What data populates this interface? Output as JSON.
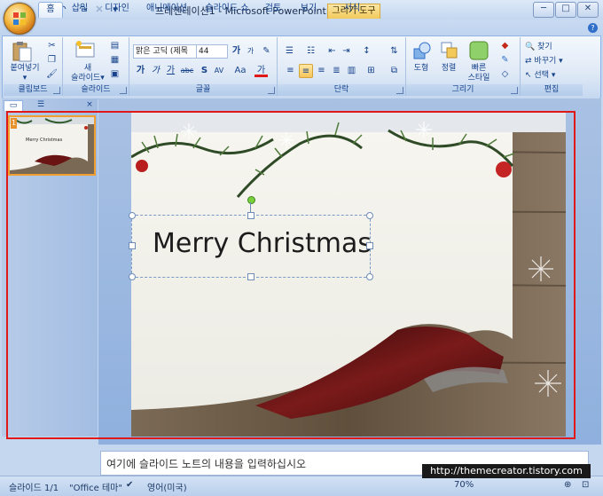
{
  "window": {
    "title": "프레젠테이션1 - Microsoft PowerPoint",
    "context_tab": "그리기 도구",
    "min": "─",
    "max": "□",
    "close": "✕"
  },
  "qat": {
    "save": "💾",
    "undo": "↶",
    "redo": "↷",
    "more": "▾"
  },
  "tabs": [
    {
      "label": "홈",
      "active": true
    },
    {
      "label": "삽입"
    },
    {
      "label": "디자인"
    },
    {
      "label": "애니메이션"
    },
    {
      "label": "슬라이드 쇼"
    },
    {
      "label": "검토"
    },
    {
      "label": "보기"
    },
    {
      "label": "서식"
    }
  ],
  "ribbon": {
    "clipboard": {
      "label": "클립보드",
      "paste": "붙여넣기",
      "paste_arrow": "▾"
    },
    "slides": {
      "label": "슬라이드",
      "new_slide_line1": "새",
      "new_slide_line2": "슬라이드",
      "arrow": "▾"
    },
    "font": {
      "label": "글꼴",
      "font_name": "맑은 고딕 (제목",
      "font_size": "44",
      "grow": "가",
      "shrink": "가",
      "bold": "가",
      "italic": "가",
      "underline": "가",
      "strike": "abc",
      "shadow": "S",
      "spacing": "AV",
      "case": "Aa",
      "color": "가"
    },
    "paragraph": {
      "label": "단락"
    },
    "drawing": {
      "label": "그리기",
      "shape": "도형",
      "arrange": "정렬",
      "quick_style_line1": "빠른",
      "quick_style_line2": "스타일"
    },
    "editing": {
      "label": "편집",
      "find": "찾기",
      "replace": "바꾸기",
      "select": "선택"
    }
  },
  "left_pane": {
    "slide_number": "1",
    "thumb_title": "Merry Christmas",
    "close": "×"
  },
  "slide": {
    "title": "Merry Christmas"
  },
  "notes": {
    "placeholder": "여기에 슬라이드 노트의 내용을 입력하십시오"
  },
  "status": {
    "slide_info": "슬라이드 1/1",
    "theme": "\"Office 테마\"",
    "language": "영어(미국)",
    "zoom": "70%"
  },
  "watermark": "http://themecreator.tistory.com",
  "colors": {
    "accent": "#15428b",
    "selection": "#e01818",
    "brand": "#f2b53a"
  }
}
